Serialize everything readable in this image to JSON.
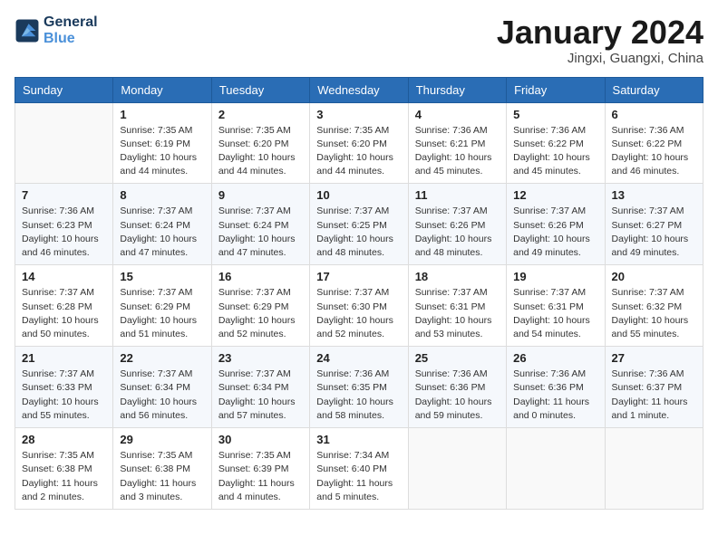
{
  "header": {
    "logo_line1": "General",
    "logo_line2": "Blue",
    "month": "January 2024",
    "location": "Jingxi, Guangxi, China"
  },
  "weekdays": [
    "Sunday",
    "Monday",
    "Tuesday",
    "Wednesday",
    "Thursday",
    "Friday",
    "Saturday"
  ],
  "weeks": [
    [
      {
        "day": "",
        "info": ""
      },
      {
        "day": "1",
        "info": "Sunrise: 7:35 AM\nSunset: 6:19 PM\nDaylight: 10 hours\nand 44 minutes."
      },
      {
        "day": "2",
        "info": "Sunrise: 7:35 AM\nSunset: 6:20 PM\nDaylight: 10 hours\nand 44 minutes."
      },
      {
        "day": "3",
        "info": "Sunrise: 7:35 AM\nSunset: 6:20 PM\nDaylight: 10 hours\nand 44 minutes."
      },
      {
        "day": "4",
        "info": "Sunrise: 7:36 AM\nSunset: 6:21 PM\nDaylight: 10 hours\nand 45 minutes."
      },
      {
        "day": "5",
        "info": "Sunrise: 7:36 AM\nSunset: 6:22 PM\nDaylight: 10 hours\nand 45 minutes."
      },
      {
        "day": "6",
        "info": "Sunrise: 7:36 AM\nSunset: 6:22 PM\nDaylight: 10 hours\nand 46 minutes."
      }
    ],
    [
      {
        "day": "7",
        "info": "Sunrise: 7:36 AM\nSunset: 6:23 PM\nDaylight: 10 hours\nand 46 minutes."
      },
      {
        "day": "8",
        "info": "Sunrise: 7:37 AM\nSunset: 6:24 PM\nDaylight: 10 hours\nand 47 minutes."
      },
      {
        "day": "9",
        "info": "Sunrise: 7:37 AM\nSunset: 6:24 PM\nDaylight: 10 hours\nand 47 minutes."
      },
      {
        "day": "10",
        "info": "Sunrise: 7:37 AM\nSunset: 6:25 PM\nDaylight: 10 hours\nand 48 minutes."
      },
      {
        "day": "11",
        "info": "Sunrise: 7:37 AM\nSunset: 6:26 PM\nDaylight: 10 hours\nand 48 minutes."
      },
      {
        "day": "12",
        "info": "Sunrise: 7:37 AM\nSunset: 6:26 PM\nDaylight: 10 hours\nand 49 minutes."
      },
      {
        "day": "13",
        "info": "Sunrise: 7:37 AM\nSunset: 6:27 PM\nDaylight: 10 hours\nand 49 minutes."
      }
    ],
    [
      {
        "day": "14",
        "info": "Sunrise: 7:37 AM\nSunset: 6:28 PM\nDaylight: 10 hours\nand 50 minutes."
      },
      {
        "day": "15",
        "info": "Sunrise: 7:37 AM\nSunset: 6:29 PM\nDaylight: 10 hours\nand 51 minutes."
      },
      {
        "day": "16",
        "info": "Sunrise: 7:37 AM\nSunset: 6:29 PM\nDaylight: 10 hours\nand 52 minutes."
      },
      {
        "day": "17",
        "info": "Sunrise: 7:37 AM\nSunset: 6:30 PM\nDaylight: 10 hours\nand 52 minutes."
      },
      {
        "day": "18",
        "info": "Sunrise: 7:37 AM\nSunset: 6:31 PM\nDaylight: 10 hours\nand 53 minutes."
      },
      {
        "day": "19",
        "info": "Sunrise: 7:37 AM\nSunset: 6:31 PM\nDaylight: 10 hours\nand 54 minutes."
      },
      {
        "day": "20",
        "info": "Sunrise: 7:37 AM\nSunset: 6:32 PM\nDaylight: 10 hours\nand 55 minutes."
      }
    ],
    [
      {
        "day": "21",
        "info": "Sunrise: 7:37 AM\nSunset: 6:33 PM\nDaylight: 10 hours\nand 55 minutes."
      },
      {
        "day": "22",
        "info": "Sunrise: 7:37 AM\nSunset: 6:34 PM\nDaylight: 10 hours\nand 56 minutes."
      },
      {
        "day": "23",
        "info": "Sunrise: 7:37 AM\nSunset: 6:34 PM\nDaylight: 10 hours\nand 57 minutes."
      },
      {
        "day": "24",
        "info": "Sunrise: 7:36 AM\nSunset: 6:35 PM\nDaylight: 10 hours\nand 58 minutes."
      },
      {
        "day": "25",
        "info": "Sunrise: 7:36 AM\nSunset: 6:36 PM\nDaylight: 10 hours\nand 59 minutes."
      },
      {
        "day": "26",
        "info": "Sunrise: 7:36 AM\nSunset: 6:36 PM\nDaylight: 11 hours\nand 0 minutes."
      },
      {
        "day": "27",
        "info": "Sunrise: 7:36 AM\nSunset: 6:37 PM\nDaylight: 11 hours\nand 1 minute."
      }
    ],
    [
      {
        "day": "28",
        "info": "Sunrise: 7:35 AM\nSunset: 6:38 PM\nDaylight: 11 hours\nand 2 minutes."
      },
      {
        "day": "29",
        "info": "Sunrise: 7:35 AM\nSunset: 6:38 PM\nDaylight: 11 hours\nand 3 minutes."
      },
      {
        "day": "30",
        "info": "Sunrise: 7:35 AM\nSunset: 6:39 PM\nDaylight: 11 hours\nand 4 minutes."
      },
      {
        "day": "31",
        "info": "Sunrise: 7:34 AM\nSunset: 6:40 PM\nDaylight: 11 hours\nand 5 minutes."
      },
      {
        "day": "",
        "info": ""
      },
      {
        "day": "",
        "info": ""
      },
      {
        "day": "",
        "info": ""
      }
    ]
  ]
}
